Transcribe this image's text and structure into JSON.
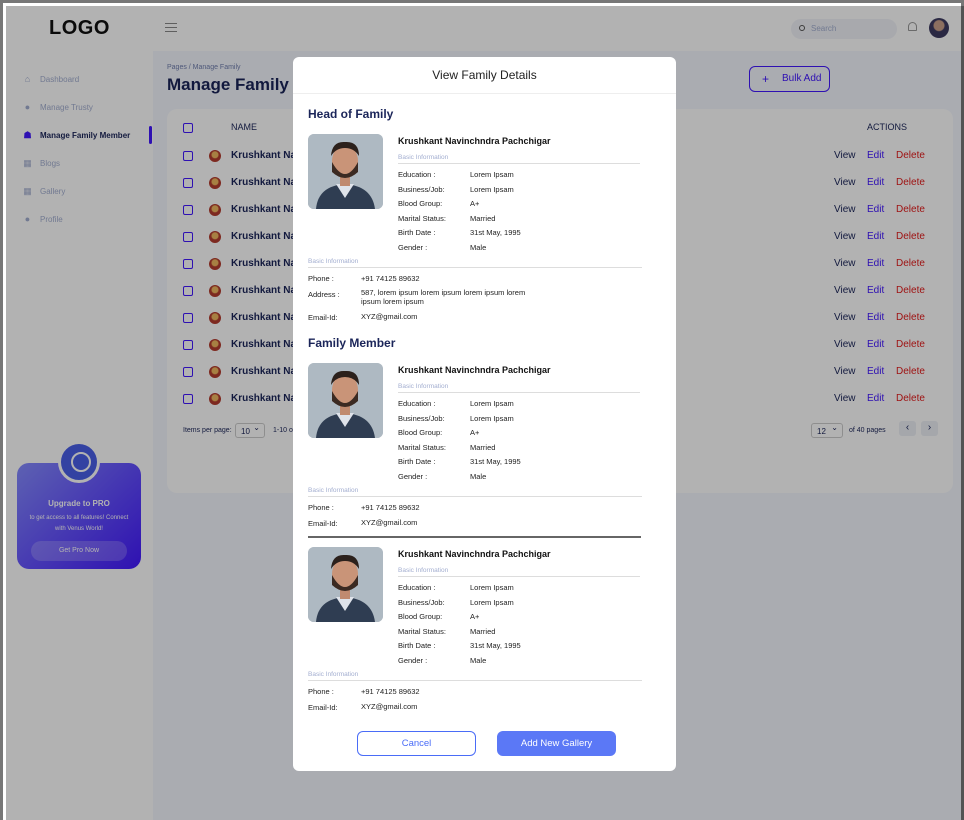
{
  "topbar": {
    "logo": "LOGO",
    "search_placeholder": "Search"
  },
  "sidebar": {
    "items": [
      {
        "label": "Dashboard",
        "icon": "home-icon"
      },
      {
        "label": "Manage Trusty",
        "icon": "person-icon"
      },
      {
        "label": "Manage Family Member",
        "icon": "family-icon",
        "active": true
      },
      {
        "label": "Blogs",
        "icon": "grid-icon"
      },
      {
        "label": "Gallery",
        "icon": "grid-icon"
      },
      {
        "label": "Profile",
        "icon": "person-icon"
      }
    ],
    "promo": {
      "title": "Upgrade to PRO",
      "text": "to get access to all features! Connect with Venus World!",
      "button": "Get Pro Now"
    }
  },
  "main": {
    "breadcrumb": "Pages / Manage Family",
    "title": "Manage Family M",
    "bulk_add": "Bulk Add",
    "table": {
      "col_name": "NAME",
      "col_actions": "ACTIONS",
      "row_name": "Krushkant Nav",
      "view": "View",
      "edit": "Edit",
      "delete": "Delete",
      "row_count": 10
    },
    "footer": {
      "items_per_page_label": "Items per page:",
      "items_per_page": "10",
      "range": "1-10 o",
      "page": "12",
      "pages_label": "of 40 pages"
    }
  },
  "modal": {
    "title": "View Family Details",
    "head_section": "Head of Family",
    "member_section": "Family Member",
    "head": {
      "name": "Krushkant Navinchndra Pachchigar",
      "basic_info": "Basic Information",
      "fields": [
        {
          "label": "Education :",
          "value": "Lorem Ipsam"
        },
        {
          "label": "Business/Job:",
          "value": "Lorem Ipsam"
        },
        {
          "label": "Blood Group:",
          "value": "A+"
        },
        {
          "label": "Marital Status:",
          "value": "Married"
        },
        {
          "label": "Birth Date :",
          "value": "31st May, 1995"
        },
        {
          "label": "Gender :",
          "value": "Male"
        }
      ],
      "contact_info": "Basic Information",
      "phone_label": "Phone :",
      "phone": "+91 74125 89632",
      "address_label": "Address :",
      "address": "587, lorem ipsum lorem ipsum lorem ipsum lorem ipsum lorem ipsum",
      "email_label": "Email-Id:",
      "email": "XYZ@gmail.com"
    },
    "members": [
      {
        "name": "Krushkant Navinchndra Pachchigar",
        "basic_info": "Basic Information",
        "fields": [
          {
            "label": "Education :",
            "value": "Lorem Ipsam"
          },
          {
            "label": "Business/Job:",
            "value": "Lorem Ipsam"
          },
          {
            "label": "Blood Group:",
            "value": "A+"
          },
          {
            "label": "Marital Status:",
            "value": "Married"
          },
          {
            "label": "Birth Date :",
            "value": "31st May, 1995"
          },
          {
            "label": "Gender :",
            "value": "Male"
          }
        ],
        "contact_info": "Basic Information",
        "phone_label": "Phone :",
        "phone": "+91 74125 89632",
        "email_label": "Email-Id:",
        "email": "XYZ@gmail.com"
      },
      {
        "name": "Krushkant Navinchndra Pachchigar",
        "basic_info": "Basic Information",
        "fields": [
          {
            "label": "Education :",
            "value": "Lorem Ipsam"
          },
          {
            "label": "Business/Job:",
            "value": "Lorem Ipsam"
          },
          {
            "label": "Blood Group:",
            "value": "A+"
          },
          {
            "label": "Marital Status:",
            "value": "Married"
          },
          {
            "label": "Birth Date :",
            "value": "31st May, 1995"
          },
          {
            "label": "Gender :",
            "value": "Male"
          }
        ],
        "contact_info": "Basic Information",
        "phone_label": "Phone :",
        "phone": "+91 74125 89632",
        "email_label": "Email-Id:",
        "email": "XYZ@gmail.com"
      }
    ],
    "cancel": "Cancel",
    "add_gallery": "Add New Gallery"
  }
}
